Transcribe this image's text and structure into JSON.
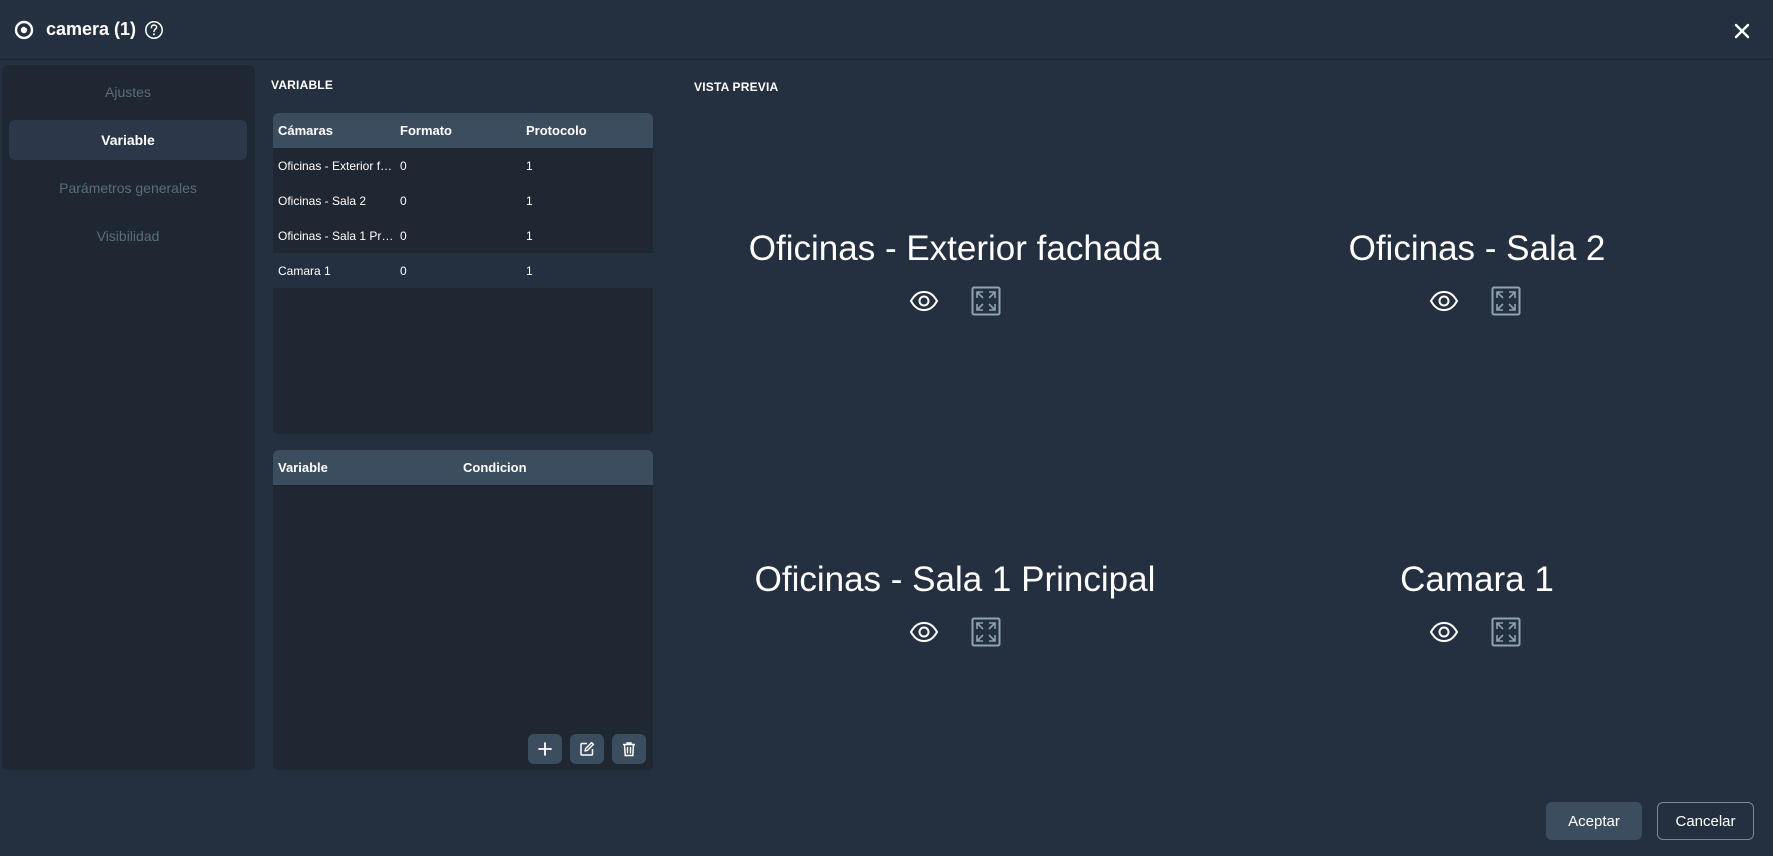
{
  "window": {
    "title": "camera (1)",
    "close_label": "×"
  },
  "sidebar": {
    "items": [
      {
        "label": "Ajustes",
        "active": false
      },
      {
        "label": "Variable",
        "active": true
      },
      {
        "label": "Parámetros generales",
        "active": false
      },
      {
        "label": "Visibilidad",
        "active": false
      }
    ]
  },
  "variable_section": {
    "heading": "VARIABLE",
    "cameras_table": {
      "headers": [
        "Cámaras",
        "Formato",
        "Protocolo"
      ],
      "rows": [
        [
          "Oficinas - Exterior fachada",
          "0",
          "1"
        ],
        [
          "Oficinas - Sala 2",
          "0",
          "1"
        ],
        [
          "Oficinas - Sala 1 Principal",
          "0",
          "1"
        ],
        [
          "Camara 1",
          "0",
          "1"
        ]
      ],
      "selected_row": 3
    },
    "conditions_table": {
      "headers": [
        "Variable",
        "Condicion"
      ],
      "rows": []
    }
  },
  "preview": {
    "heading": "VISTA PREVIA",
    "cameras": [
      {
        "name": "Oficinas - Exterior fachada"
      },
      {
        "name": "Oficinas - Sala 2"
      },
      {
        "name": "Oficinas - Sala 1 Principal"
      },
      {
        "name": "Camara 1"
      }
    ]
  },
  "footer": {
    "accept_label": "Aceptar",
    "cancel_label": "Cancelar"
  },
  "colors": {
    "background": "#243040",
    "panel": "#1e2732",
    "header": "#3d4d60",
    "muted_text": "#5e6c7c",
    "icon": "#8fa3b3"
  }
}
